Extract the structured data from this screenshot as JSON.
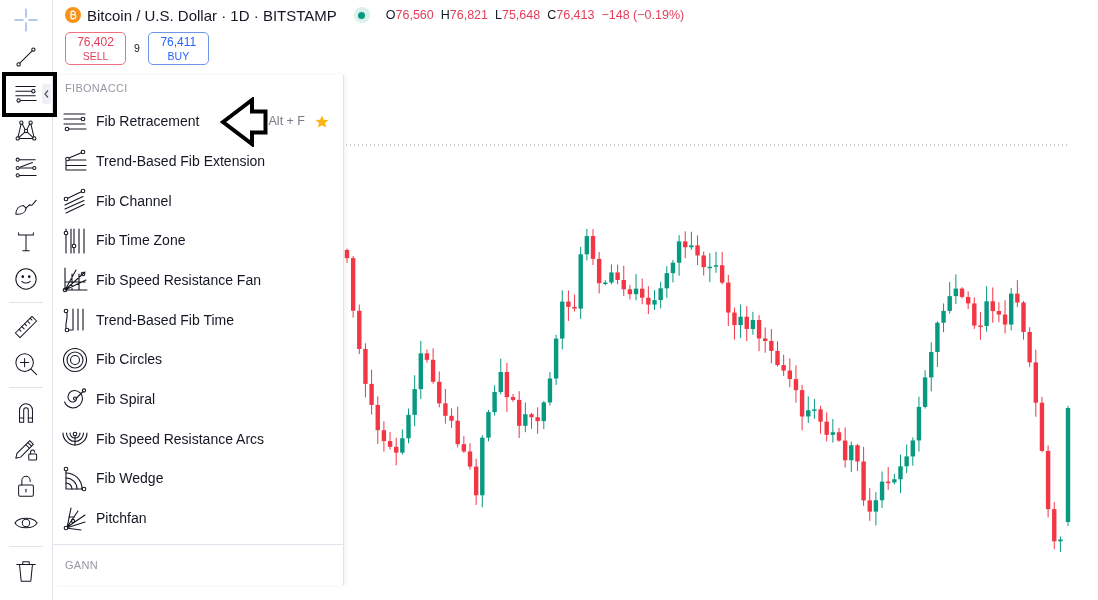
{
  "toolbar": {
    "groups": [
      {
        "tools": [
          {
            "selected": true,
            "expanded": false
          },
          {
            "selected": false,
            "expanded": false
          },
          {
            "selected": false,
            "expanded": true
          },
          {
            "selected": false,
            "expanded": false
          },
          {
            "selected": false,
            "expanded": false
          },
          {
            "selected": false,
            "expanded": false
          },
          {
            "selected": false,
            "expanded": false
          },
          {
            "selected": false,
            "expanded": false
          }
        ]
      },
      {
        "tools": [
          {
            "selected": false,
            "expanded": false
          },
          {
            "selected": false,
            "expanded": false
          }
        ]
      },
      {
        "tools": [
          {
            "selected": false,
            "expanded": false
          },
          {
            "selected": false,
            "expanded": false
          },
          {
            "selected": false,
            "expanded": false
          },
          {
            "selected": false,
            "expanded": false
          }
        ]
      },
      {
        "tools": [
          {
            "selected": false,
            "expanded": false
          }
        ]
      }
    ]
  },
  "symbol": {
    "title": "Bitcoin / U.S. Dollar · 1D · BITSTAMP",
    "ohlc": [
      {
        "label": "O",
        "value": "76,560"
      },
      {
        "label": "H",
        "value": "76,821"
      },
      {
        "label": "L",
        "value": "75,648"
      },
      {
        "label": "C",
        "value": "76,413"
      }
    ],
    "change": "−148 (−0.19%)"
  },
  "trade": {
    "sell": {
      "price": "76,402",
      "label": "SELL"
    },
    "spread": "9",
    "buy": {
      "price": "76,411",
      "label": "BUY"
    }
  },
  "drawing_menu": {
    "sections": [
      {
        "title": "FIBONACCI",
        "items": [
          {
            "label": "Fib Retracement",
            "shortcut": "Alt + F",
            "favorite": true
          },
          {
            "label": "Trend-Based Fib Extension",
            "favorite": false
          },
          {
            "label": "Fib Channel",
            "favorite": false
          },
          {
            "label": "Fib Time Zone",
            "favorite": false
          },
          {
            "label": "Fib Speed Resistance Fan",
            "favorite": false
          },
          {
            "label": "Trend-Based Fib Time",
            "favorite": false
          },
          {
            "label": "Fib Circles",
            "favorite": false
          },
          {
            "label": "Fib Spiral",
            "favorite": false
          },
          {
            "label": "Fib Speed Resistance Arcs",
            "favorite": false
          },
          {
            "label": "Fib Wedge",
            "favorite": false
          },
          {
            "label": "Pitchfan",
            "favorite": false
          }
        ]
      },
      {
        "title": "GANN"
      }
    ]
  }
}
